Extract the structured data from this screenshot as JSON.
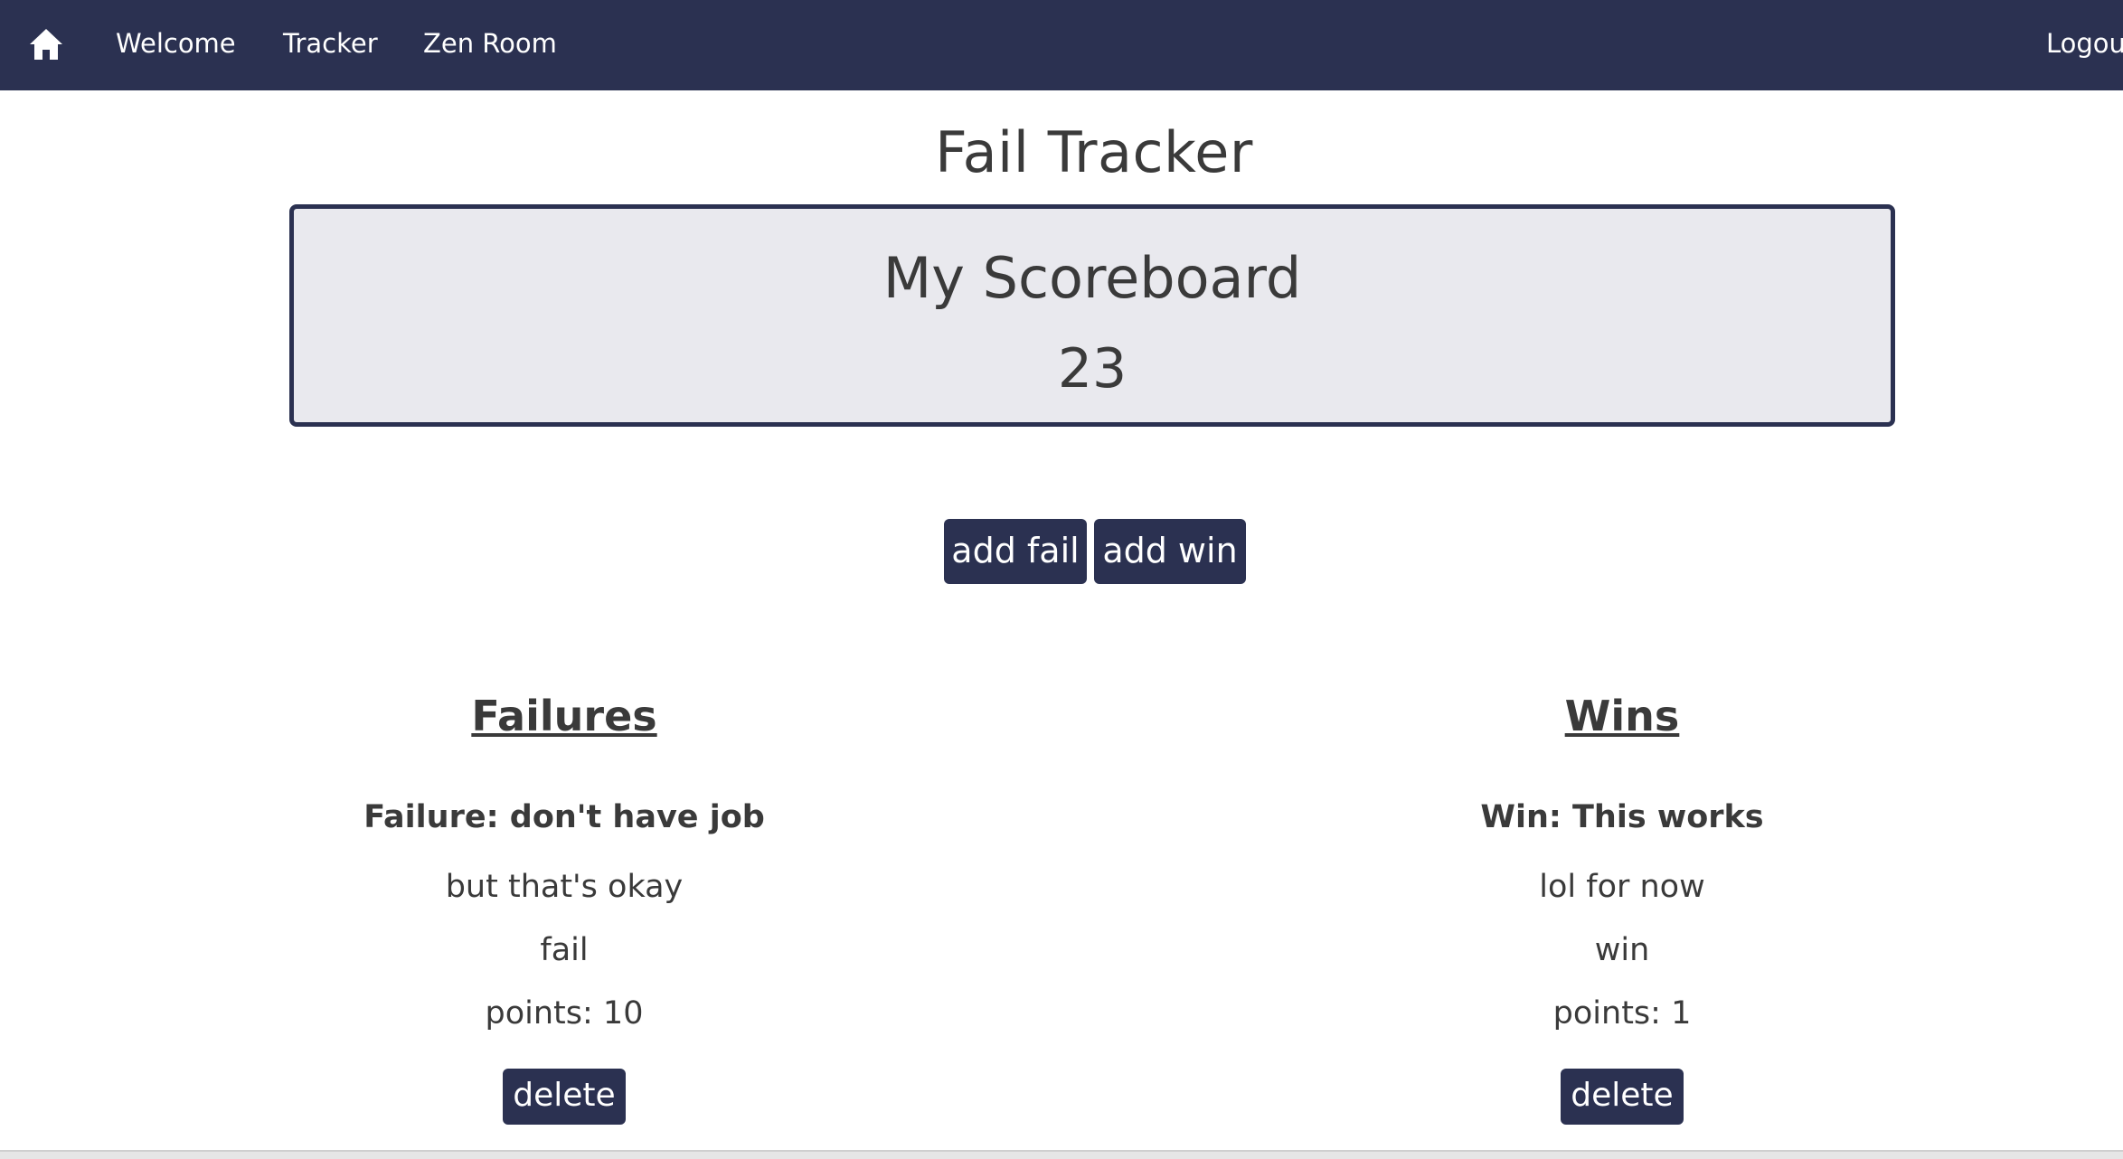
{
  "nav": {
    "home_icon": "home-icon",
    "links": [
      "Welcome",
      "Tracker",
      "Zen Room"
    ],
    "logout": "Logout",
    "background_color": "#2b3151"
  },
  "page": {
    "title": "Fail Tracker"
  },
  "scoreboard": {
    "title": "My Scoreboard",
    "score": "23"
  },
  "actions": {
    "add_fail": "add fail",
    "add_win": "add win"
  },
  "failures": {
    "heading": "Failures",
    "items": [
      {
        "title": "Failure: don't have job",
        "description": "but that's okay",
        "type": "fail",
        "points": "points: 10",
        "delete_label": "delete"
      }
    ]
  },
  "wins": {
    "heading": "Wins",
    "items": [
      {
        "title": "Win: This works",
        "description": "lol for now",
        "type": "win",
        "points": "points: 1",
        "delete_label": "delete"
      }
    ]
  }
}
